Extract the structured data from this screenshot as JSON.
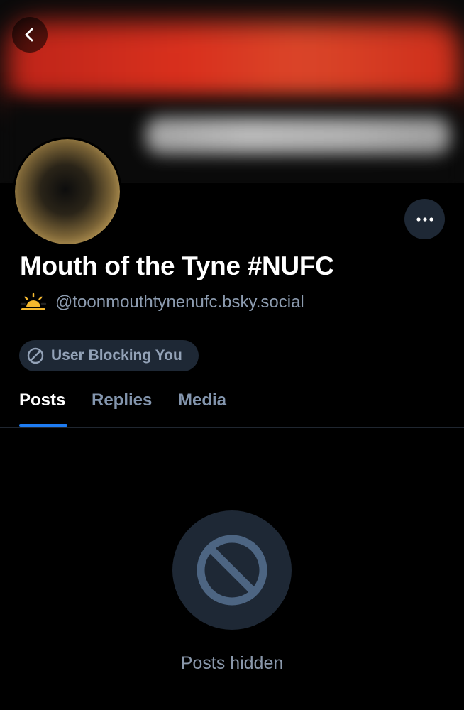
{
  "header": {
    "back_icon": "chevron-left-icon",
    "more_icon": "ellipsis-icon"
  },
  "profile": {
    "display_name": "Mouth of the Tyne #NUFC",
    "handle": "@toonmouthtynenufc.bsky.social",
    "handle_emoji": "sunrise-icon",
    "blocking_badge": {
      "icon": "block-icon",
      "label": "User Blocking You"
    }
  },
  "tabs": [
    {
      "label": "Posts",
      "active": true
    },
    {
      "label": "Replies",
      "active": false
    },
    {
      "label": "Media",
      "active": false
    }
  ],
  "content": {
    "empty_icon": "block-icon",
    "empty_label": "Posts hidden"
  },
  "colors": {
    "background": "#000000",
    "accent_blue": "#1e7cf2",
    "chip_bg": "#1e2835",
    "muted_text": "#8d9cb0"
  }
}
